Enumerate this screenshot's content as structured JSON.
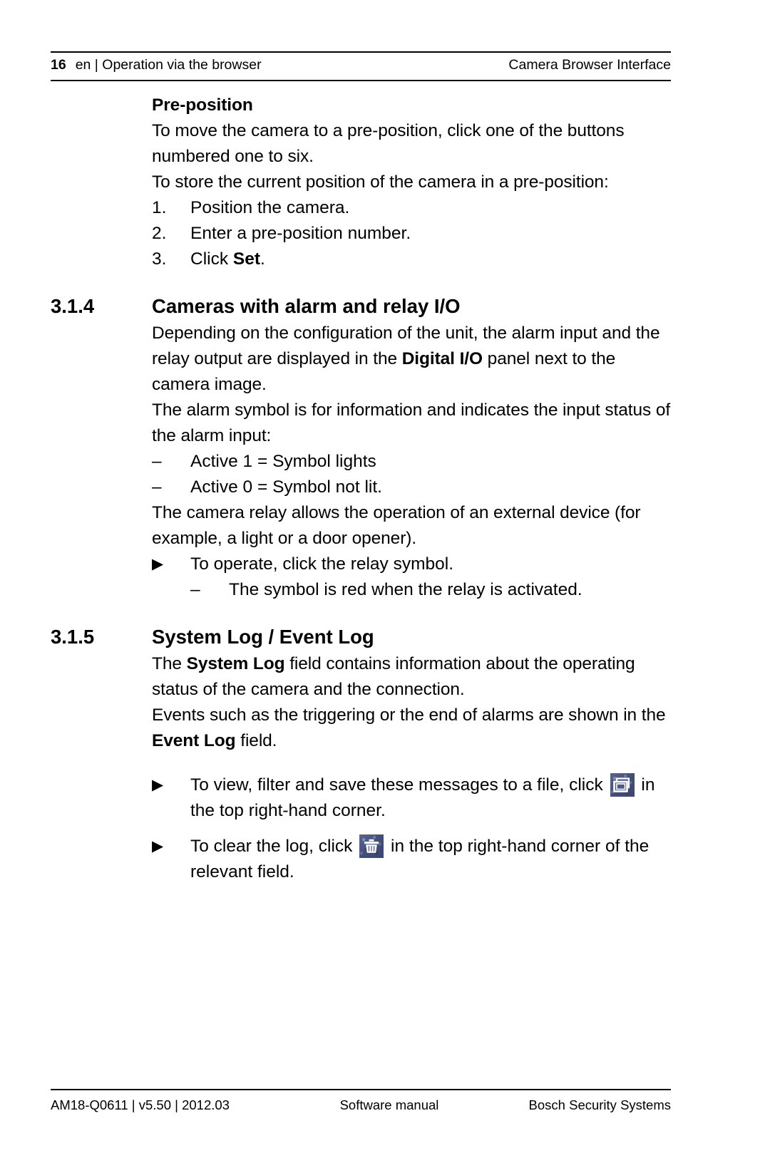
{
  "header": {
    "page_number": "16",
    "section": "en | Operation via the browser",
    "title": "Camera Browser Interface"
  },
  "content": {
    "preposition": {
      "heading": "Pre-position",
      "para1": "To move the camera to a pre-position, click one of the buttons numbered one to six.",
      "para2": "To store the current position of the camera in a pre-position:",
      "steps": [
        {
          "marker": "1.",
          "text": "Position the camera."
        },
        {
          "marker": "2.",
          "text": "Enter a pre-position number."
        },
        {
          "marker": "3.",
          "text_before": "Click ",
          "bold": "Set",
          "text_after": "."
        }
      ]
    },
    "section_314": {
      "number": "3.1.4",
      "title": "Cameras with alarm and relay I/O",
      "para1_before": "Depending on the configuration of the unit, the alarm input and the relay output are displayed in the ",
      "para1_bold": "Digital I/O",
      "para1_after": " panel next to the camera image.",
      "para2": "The alarm symbol is for information and indicates the input status of the alarm input:",
      "dashes": [
        {
          "marker": "–",
          "text": "Active 1 = Symbol lights"
        },
        {
          "marker": "–",
          "text": "Active 0 = Symbol not lit."
        }
      ],
      "para3": "The camera relay allows the operation of an external device (for example, a light or a door opener).",
      "tri1": {
        "marker": "▶",
        "text": "To operate, click the relay symbol."
      },
      "subdash1": {
        "marker": "–",
        "text": "The symbol is red when the relay is activated."
      }
    },
    "section_315": {
      "number": "3.1.5",
      "title": "System Log / Event Log",
      "para1_before": "The ",
      "para1_bold": "System Log",
      "para1_after": " field contains information about the operating status of the camera and the connection.",
      "para2_before": "Events such as the triggering or the end of alarms are shown in the ",
      "para2_bold": "Event Log",
      "para2_after": " field.",
      "tri_view": {
        "marker": "▶",
        "text_before": "To view, filter and save these messages to a file, click ",
        "icon": "save-window-icon",
        "text_after": " in the top right-hand corner."
      },
      "tri_clear": {
        "marker": "▶",
        "text_before": "To clear the log, click ",
        "icon": "trash-icon",
        "text_after": " in the top right-hand corner of the relevant field."
      }
    }
  },
  "footer": {
    "left": "AM18-Q0611 | v5.50 | 2012.03",
    "center": "Software manual",
    "right": "Bosch Security Systems"
  },
  "colors": {
    "icon_background": "#4d5884",
    "icon_glyph": "#ffffff",
    "rule": "#000000"
  }
}
